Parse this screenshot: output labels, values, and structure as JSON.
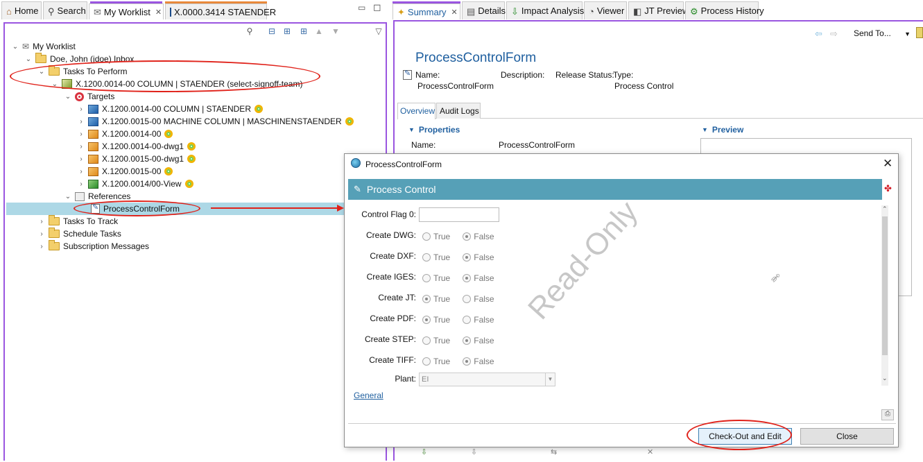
{
  "left_tabs": [
    {
      "label": "Home",
      "icon": "home-icon"
    },
    {
      "label": "Search",
      "icon": "search-icon"
    },
    {
      "label": "My Worklist",
      "icon": "worklist-icon",
      "active": true
    },
    {
      "label": "X.0000.3414 STAENDER",
      "icon": "item-cube-icon"
    }
  ],
  "right_tabs": [
    {
      "label": "Summary",
      "icon": "summary-icon",
      "active": true
    },
    {
      "label": "Details",
      "icon": "details-icon"
    },
    {
      "label": "Impact Analysis",
      "icon": "impact-analysis-icon"
    },
    {
      "label": "Viewer",
      "icon": "viewer-icon"
    },
    {
      "label": "JT Preview",
      "icon": "jt-preview-icon"
    },
    {
      "label": "Process History",
      "icon": "process-history-icon"
    }
  ],
  "tree": {
    "root": "My Worklist",
    "inbox": "Doe, John (jdoe) Inbox",
    "tasks_to_perform": "Tasks To Perform",
    "task": "X.1200.0014-00 COLUMN | STAENDER (select-signoff-team)",
    "targets_label": "Targets",
    "targets": [
      "X.1200.0014-00 COLUMN | STAENDER",
      "X.1200.0015-00 MACHINE COLUMN | MASCHINENSTAENDER",
      "X.1200.0014-00",
      "X.1200.0014-00-dwg1",
      "X.1200.0015-00-dwg1",
      "X.1200.0015-00",
      "X.1200.0014/00-View"
    ],
    "references_label": "References",
    "reference": "ProcessControlForm",
    "tasks_to_track": "Tasks To Track",
    "schedule_tasks": "Schedule Tasks",
    "subscription_messages": "Subscription Messages"
  },
  "summary": {
    "send_to": "Send To...",
    "title": "ProcessControlForm",
    "name_label": "Name:",
    "name_value": "ProcessControlForm",
    "description_label": "Description:",
    "release_status_label": "Release Status:",
    "type_label": "Type:",
    "type_value": "Process Control",
    "subtabs": [
      "Overview",
      "Audit Logs"
    ],
    "properties_label": "Properties",
    "preview_label": "Preview",
    "prop_name_label": "Name:",
    "prop_name_value": "ProcessControlForm"
  },
  "dialog": {
    "title": "ProcessControlForm",
    "header": "Process Control",
    "control_flag_label": "Control Flag 0:",
    "control_flag_value": "",
    "true_label": "True",
    "false_label": "False",
    "fields": [
      {
        "label": "Create DWG:",
        "value": "False"
      },
      {
        "label": "Create DXF:",
        "value": "False"
      },
      {
        "label": "Create IGES:",
        "value": "False"
      },
      {
        "label": "Create JT:",
        "value": "True"
      },
      {
        "label": "Create PDF:",
        "value": "True"
      },
      {
        "label": "Create STEP:",
        "value": "False"
      },
      {
        "label": "Create TIFF:",
        "value": "False"
      }
    ],
    "plant_label": "Plant:",
    "plant_value": "EI",
    "watermark": "Read-Only",
    "general_link": "General",
    "checkout_button": "Check-Out and Edit",
    "close_button": "Close"
  },
  "colors": {
    "accent_border": "#9a55e0",
    "dialog_header": "#56a0b7",
    "annotation_red": "#e0221a",
    "selection": "#add8e6"
  }
}
